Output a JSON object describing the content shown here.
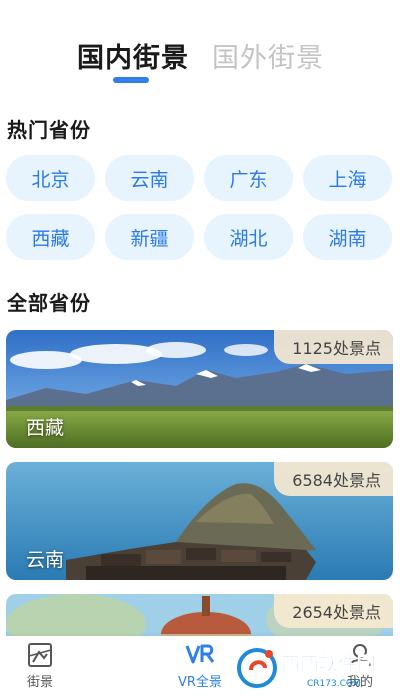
{
  "tabs": [
    {
      "label": "国内街景",
      "active": true
    },
    {
      "label": "国外街景",
      "active": false
    }
  ],
  "hot_section": {
    "title": "热门省份"
  },
  "hot_provinces": [
    "北京",
    "云南",
    "广东",
    "上海",
    "西藏",
    "新疆",
    "湖北",
    "湖南"
  ],
  "all_section": {
    "title": "全部省份"
  },
  "province_cards": [
    {
      "name": "西藏",
      "count": "1125处景点",
      "scene": "mountains"
    },
    {
      "name": "云南",
      "count": "6584处景点",
      "scene": "lake-island"
    },
    {
      "name": "",
      "count": "2654处景点",
      "scene": "tower"
    }
  ],
  "bottom_nav": [
    {
      "label": "街景",
      "icon": "map-icon",
      "active": false
    },
    {
      "label": "VR全景",
      "icon": "vr-icon",
      "active": true
    },
    {
      "label": "我的",
      "icon": "user-icon",
      "active": false
    }
  ],
  "watermark": {
    "text": "西西软件园",
    "subtext": "CR173.COM"
  },
  "colors": {
    "accent": "#2f7fe6",
    "chip_bg": "#e7f3fd",
    "chip_text": "#2c7be5",
    "badge_bg": "#f6e8d0"
  }
}
